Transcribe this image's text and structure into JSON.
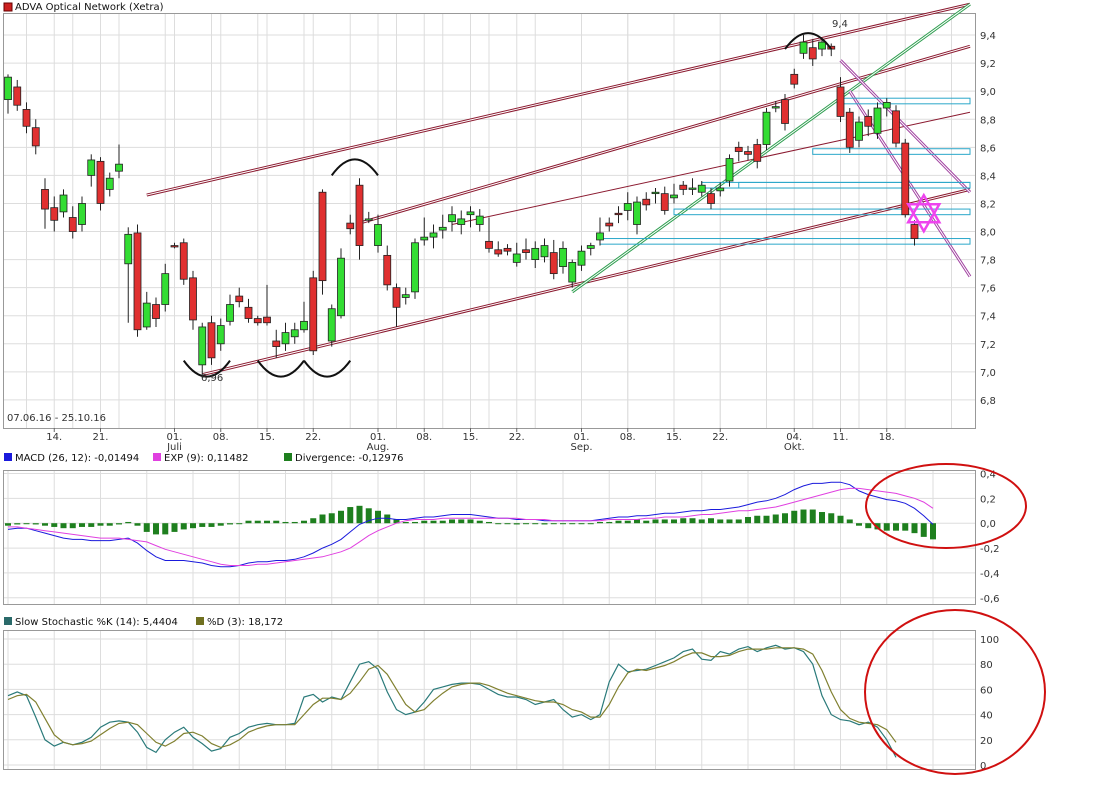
{
  "chart_data": [
    {
      "type": "candlestick",
      "title": "ADVA Optical Network (Xetra)",
      "date_range": "07.06.16 - 25.10.16",
      "ylim": [
        6.6,
        9.55
      ],
      "y_ticks": [
        6.8,
        7.0,
        7.2,
        7.4,
        7.6,
        7.8,
        8.0,
        8.2,
        8.4,
        8.6,
        8.8,
        9.0,
        9.2,
        9.4
      ],
      "y_tick_labels": [
        "6,8",
        "7,0",
        "7,2",
        "7,4",
        "7,6",
        "7,8",
        "8,0",
        "8,2",
        "8,4",
        "8,6",
        "8,8",
        "9,0",
        "9,2",
        "9,4"
      ],
      "x_tick_labels": [
        {
          "day": "14.",
          "index": 5
        },
        {
          "day": "21.",
          "index": 10
        },
        {
          "day": "01.",
          "month": "Juli",
          "index": 18
        },
        {
          "day": "08.",
          "index": 23
        },
        {
          "day": "15.",
          "index": 28
        },
        {
          "day": "22.",
          "index": 33
        },
        {
          "day": "01.",
          "month": "Aug.",
          "index": 40
        },
        {
          "day": "08.",
          "index": 45
        },
        {
          "day": "15.",
          "index": 50
        },
        {
          "day": "22.",
          "index": 55
        },
        {
          "day": "01.",
          "month": "Sep.",
          "index": 62
        },
        {
          "day": "08.",
          "index": 67
        },
        {
          "day": "15.",
          "index": 72
        },
        {
          "day": "22.",
          "index": 77
        },
        {
          "day": "04.",
          "month": "Okt.",
          "index": 85
        },
        {
          "day": "11.",
          "index": 90
        },
        {
          "day": "18.",
          "index": 95
        }
      ],
      "low_annotation": {
        "text": "6,96",
        "index": 21,
        "value": 6.96
      },
      "high_annotation": {
        "text": "9,4",
        "index": 86,
        "value": 9.45
      },
      "candles": [
        [
          8.94,
          9.1,
          9.12,
          8.84
        ],
        [
          9.03,
          8.9,
          9.08,
          8.86
        ],
        [
          8.87,
          8.75,
          8.92,
          8.7
        ],
        [
          8.74,
          8.61,
          8.8,
          8.55
        ],
        [
          8.3,
          8.16,
          8.38,
          8.02
        ],
        [
          8.17,
          8.08,
          8.25,
          8.0
        ],
        [
          8.14,
          8.26,
          8.3,
          8.1
        ],
        [
          8.1,
          8.0,
          8.18,
          7.95
        ],
        [
          8.05,
          8.2,
          8.25,
          8.0
        ],
        [
          8.4,
          8.51,
          8.55,
          8.32
        ],
        [
          8.5,
          8.2,
          8.53,
          8.15
        ],
        [
          8.3,
          8.38,
          8.42,
          8.25
        ],
        [
          8.43,
          8.48,
          8.62,
          8.38
        ],
        [
          7.77,
          7.98,
          8.03,
          7.35
        ],
        [
          7.99,
          7.3,
          8.05,
          7.25
        ],
        [
          7.32,
          7.49,
          7.57,
          7.3
        ],
        [
          7.48,
          7.38,
          7.53,
          7.32
        ],
        [
          7.48,
          7.7,
          7.77,
          7.43
        ],
        [
          7.9,
          7.89,
          7.92,
          7.88
        ],
        [
          7.92,
          7.66,
          7.95,
          7.62
        ],
        [
          7.67,
          7.37,
          7.72,
          7.3
        ],
        [
          7.05,
          7.32,
          7.35,
          6.96
        ],
        [
          7.35,
          7.1,
          7.4,
          7.05
        ],
        [
          7.2,
          7.33,
          7.38,
          7.15
        ],
        [
          7.36,
          7.48,
          7.55,
          7.33
        ],
        [
          7.54,
          7.5,
          7.6,
          7.46
        ],
        [
          7.46,
          7.38,
          7.52,
          7.35
        ],
        [
          7.38,
          7.35,
          7.4,
          7.33
        ],
        [
          7.39,
          7.35,
          7.62,
          7.33
        ],
        [
          7.22,
          7.18,
          7.3,
          7.1
        ],
        [
          7.2,
          7.28,
          7.35,
          7.15
        ],
        [
          7.25,
          7.3,
          7.35,
          7.2
        ],
        [
          7.3,
          7.36,
          7.5,
          7.28
        ],
        [
          7.67,
          7.15,
          7.72,
          7.12
        ],
        [
          8.28,
          7.65,
          8.3,
          7.55
        ],
        [
          7.22,
          7.45,
          7.48,
          7.18
        ],
        [
          7.4,
          7.81,
          7.88,
          7.38
        ],
        [
          8.06,
          8.02,
          8.12,
          7.98
        ],
        [
          8.33,
          7.9,
          8.38,
          7.8
        ],
        [
          8.08,
          8.09,
          8.14,
          8.06
        ],
        [
          7.9,
          8.05,
          8.12,
          7.85
        ],
        [
          7.83,
          7.62,
          7.9,
          7.58
        ],
        [
          7.6,
          7.46,
          7.63,
          7.32
        ],
        [
          7.53,
          7.55,
          7.6,
          7.48
        ],
        [
          7.57,
          7.92,
          7.95,
          7.52
        ],
        [
          7.94,
          7.96,
          8.1,
          7.9
        ],
        [
          7.96,
          7.99,
          8.05,
          7.88
        ],
        [
          8.01,
          8.03,
          8.12,
          7.95
        ],
        [
          8.07,
          8.12,
          8.18,
          8.0
        ],
        [
          8.05,
          8.09,
          8.15,
          7.98
        ],
        [
          8.12,
          8.14,
          8.18,
          8.03
        ],
        [
          8.05,
          8.11,
          8.16,
          8.0
        ],
        [
          7.93,
          7.88,
          8.1,
          7.85
        ],
        [
          7.87,
          7.84,
          7.93,
          7.82
        ],
        [
          7.88,
          7.86,
          7.91,
          7.83
        ],
        [
          7.78,
          7.84,
          7.92,
          7.75
        ],
        [
          7.87,
          7.85,
          7.95,
          7.8
        ],
        [
          7.8,
          7.88,
          7.93,
          7.74
        ],
        [
          7.82,
          7.9,
          7.95,
          7.78
        ],
        [
          7.85,
          7.7,
          7.94,
          7.66
        ],
        [
          7.75,
          7.88,
          7.93,
          7.7
        ],
        [
          7.64,
          7.78,
          7.8,
          7.6
        ],
        [
          7.76,
          7.86,
          7.9,
          7.72
        ],
        [
          7.88,
          7.9,
          7.92,
          7.83
        ],
        [
          7.94,
          7.99,
          8.1,
          7.9
        ],
        [
          8.06,
          8.04,
          8.1,
          8.0
        ],
        [
          8.13,
          8.12,
          8.18,
          8.06
        ],
        [
          8.15,
          8.2,
          8.28,
          8.08
        ],
        [
          8.05,
          8.21,
          8.25,
          7.98
        ],
        [
          8.23,
          8.19,
          8.28,
          8.15
        ],
        [
          8.27,
          8.28,
          8.31,
          8.2
        ],
        [
          8.27,
          8.15,
          8.32,
          8.12
        ],
        [
          8.24,
          8.26,
          8.34,
          8.2
        ],
        [
          8.33,
          8.3,
          8.36,
          8.26
        ],
        [
          8.3,
          8.31,
          8.38,
          8.26
        ],
        [
          8.28,
          8.33,
          8.36,
          8.25
        ],
        [
          8.27,
          8.2,
          8.31,
          8.16
        ],
        [
          8.29,
          8.31,
          8.35,
          8.25
        ],
        [
          8.36,
          8.52,
          8.55,
          8.32
        ],
        [
          8.6,
          8.57,
          8.64,
          8.5
        ],
        [
          8.57,
          8.55,
          8.61,
          8.51
        ],
        [
          8.62,
          8.5,
          8.66,
          8.45
        ],
        [
          8.62,
          8.85,
          8.88,
          8.58
        ],
        [
          8.88,
          8.89,
          8.93,
          8.85
        ],
        [
          8.94,
          8.77,
          8.98,
          8.72
        ],
        [
          9.12,
          9.05,
          9.16,
          9.02
        ],
        [
          9.27,
          9.35,
          9.4,
          9.23
        ],
        [
          9.31,
          9.23,
          9.37,
          9.18
        ],
        [
          9.3,
          9.35,
          9.37,
          9.25
        ],
        [
          9.32,
          9.3,
          9.34,
          9.25
        ],
        [
          9.03,
          8.82,
          9.1,
          8.78
        ],
        [
          8.85,
          8.6,
          8.88,
          8.56
        ],
        [
          8.65,
          8.78,
          8.82,
          8.6
        ],
        [
          8.82,
          8.75,
          8.87,
          8.68
        ],
        [
          8.7,
          8.88,
          8.92,
          8.66
        ],
        [
          8.88,
          8.92,
          8.95,
          8.82
        ],
        [
          8.86,
          8.63,
          8.9,
          8.6
        ],
        [
          8.63,
          8.12,
          8.66,
          8.1
        ],
        [
          8.05,
          7.95,
          8.08,
          7.9
        ]
      ],
      "trend_lines": [
        {
          "color": "#8b1a30",
          "from": [
            15,
            8.26
          ],
          "to": [
            104,
            9.62
          ],
          "double": true
        },
        {
          "color": "#8b1a30",
          "from": [
            38,
            8.06
          ],
          "to": [
            104,
            9.32
          ],
          "double": true
        },
        {
          "color": "#8b1a30",
          "from": [
            48,
            8.05
          ],
          "to": [
            104,
            8.85
          ],
          "double": false
        },
        {
          "color": "#8b1a30",
          "from": [
            21,
            6.98
          ],
          "to": [
            104,
            8.3
          ],
          "double": true
        },
        {
          "color": "#2e9e4f",
          "from": [
            61,
            7.57
          ],
          "to": [
            104,
            9.62
          ],
          "double": true
        },
        {
          "color": "#a040a0",
          "from": [
            90,
            9.22
          ],
          "to": [
            104,
            8.28
          ],
          "double": true
        },
        {
          "color": "#a040a0",
          "from": [
            91,
            9.0
          ],
          "to": [
            104,
            7.68
          ],
          "double": true
        }
      ],
      "resistance_boxes": [
        {
          "from": [
            79,
            8.35
          ],
          "to": [
            104,
            8.31
          ]
        },
        {
          "from": [
            75,
            8.35
          ],
          "to": [
            104,
            8.31
          ]
        },
        {
          "from": [
            90,
            8.95
          ],
          "to": [
            104,
            8.91
          ]
        },
        {
          "from": [
            87,
            8.59
          ],
          "to": [
            104,
            8.55
          ]
        },
        {
          "from": [
            72,
            8.16
          ],
          "to": [
            104,
            8.12
          ]
        },
        {
          "from": [
            64,
            7.95
          ],
          "to": [
            104,
            7.91
          ]
        }
      ],
      "pattern_arcs": [
        {
          "x0": 19,
          "x1": 24,
          "y": 7.08,
          "type": "bottom"
        },
        {
          "x0": 27,
          "x1": 32,
          "y": 7.08,
          "type": "bottom"
        },
        {
          "x0": 32,
          "x1": 37,
          "y": 7.08,
          "type": "bottom"
        },
        {
          "x0": 35,
          "x1": 40,
          "y": 8.4,
          "type": "top"
        },
        {
          "x0": 84,
          "x1": 89,
          "y": 9.3,
          "type": "top"
        }
      ],
      "star_marker": {
        "index": 99,
        "value": 8.13,
        "color": "#ee44ee"
      }
    },
    {
      "type": "macd",
      "legend": [
        {
          "label": "MACD (26, 12): -0,01494",
          "color": "#1a1adc"
        },
        {
          "label": "EXP (9): 0,11482",
          "color": "#e040e0"
        },
        {
          "label": "Divergence: -0,12976",
          "color": "#1e7f1e"
        }
      ],
      "ylim": [
        -0.65,
        0.42
      ],
      "y_ticks": [
        0.4,
        0.2,
        0.0,
        -0.2,
        -0.4,
        -0.6
      ],
      "y_tick_labels": [
        "0,4",
        "0,2",
        "0,0",
        "-0,2",
        "-0,4",
        "-0,6"
      ],
      "macd": [
        -0.05,
        -0.04,
        -0.04,
        -0.06,
        -0.08,
        -0.1,
        -0.12,
        -0.13,
        -0.13,
        -0.14,
        -0.14,
        -0.14,
        -0.13,
        -0.12,
        -0.16,
        -0.22,
        -0.27,
        -0.3,
        -0.3,
        -0.3,
        -0.31,
        -0.32,
        -0.34,
        -0.35,
        -0.35,
        -0.34,
        -0.32,
        -0.31,
        -0.31,
        -0.3,
        -0.3,
        -0.29,
        -0.27,
        -0.24,
        -0.2,
        -0.17,
        -0.13,
        -0.07,
        -0.01,
        0.02,
        0.04,
        0.04,
        0.03,
        0.03,
        0.04,
        0.05,
        0.05,
        0.06,
        0.07,
        0.07,
        0.07,
        0.06,
        0.05,
        0.04,
        0.04,
        0.03,
        0.03,
        0.03,
        0.02,
        0.02,
        0.02,
        0.02,
        0.02,
        0.02,
        0.03,
        0.04,
        0.05,
        0.05,
        0.06,
        0.06,
        0.07,
        0.08,
        0.08,
        0.09,
        0.1,
        0.1,
        0.11,
        0.11,
        0.12,
        0.13,
        0.15,
        0.17,
        0.18,
        0.2,
        0.23,
        0.27,
        0.3,
        0.32,
        0.32,
        0.33,
        0.33,
        0.31,
        0.26,
        0.23,
        0.21,
        0.19,
        0.18,
        0.16,
        0.12,
        0.06,
        -0.01
      ],
      "exp": [
        -0.03,
        -0.03,
        -0.04,
        -0.05,
        -0.06,
        -0.07,
        -0.08,
        -0.09,
        -0.1,
        -0.11,
        -0.12,
        -0.12,
        -0.12,
        -0.13,
        -0.14,
        -0.15,
        -0.18,
        -0.21,
        -0.23,
        -0.25,
        -0.27,
        -0.29,
        -0.31,
        -0.33,
        -0.34,
        -0.34,
        -0.34,
        -0.33,
        -0.33,
        -0.32,
        -0.31,
        -0.3,
        -0.29,
        -0.28,
        -0.27,
        -0.25,
        -0.23,
        -0.2,
        -0.15,
        -0.1,
        -0.06,
        -0.03,
        0.0,
        0.02,
        0.03,
        0.03,
        0.03,
        0.04,
        0.04,
        0.04,
        0.04,
        0.04,
        0.04,
        0.04,
        0.04,
        0.04,
        0.03,
        0.03,
        0.03,
        0.02,
        0.02,
        0.02,
        0.02,
        0.02,
        0.02,
        0.03,
        0.03,
        0.03,
        0.03,
        0.04,
        0.04,
        0.05,
        0.05,
        0.05,
        0.06,
        0.07,
        0.07,
        0.08,
        0.09,
        0.1,
        0.1,
        0.11,
        0.12,
        0.13,
        0.15,
        0.17,
        0.19,
        0.21,
        0.23,
        0.25,
        0.27,
        0.28,
        0.28,
        0.27,
        0.26,
        0.25,
        0.24,
        0.22,
        0.2,
        0.17,
        0.12
      ]
    },
    {
      "type": "stochastic",
      "legend": [
        {
          "label": "Slow Stochastic %K (14): 5,4404",
          "color": "#2a6a6a"
        },
        {
          "label": "%D (3): 18,172",
          "color": "#707020"
        }
      ],
      "ylim": [
        0,
        100
      ],
      "y_ticks": [
        0,
        20,
        40,
        60,
        80,
        100
      ],
      "y_tick_labels": [
        "0",
        "20",
        "40",
        "60",
        "80",
        "100"
      ],
      "k": [
        55,
        58,
        55,
        38,
        20,
        15,
        18,
        16,
        18,
        22,
        30,
        34,
        35,
        34,
        26,
        14,
        10,
        20,
        26,
        30,
        22,
        17,
        11,
        13,
        22,
        25,
        30,
        32,
        33,
        32,
        32,
        33,
        54,
        56,
        50,
        54,
        52,
        66,
        80,
        82,
        76,
        58,
        44,
        40,
        42,
        50,
        60,
        62,
        64,
        65,
        65,
        64,
        60,
        56,
        54,
        54,
        52,
        48,
        50,
        52,
        44,
        38,
        40,
        36,
        40,
        66,
        80,
        74,
        75,
        76,
        79,
        82,
        85,
        90,
        92,
        84,
        83,
        90,
        88,
        92,
        94,
        90,
        93,
        95,
        92,
        93,
        90,
        80,
        55,
        40,
        36,
        35,
        32,
        34,
        30,
        20,
        6
      ],
      "d": [
        52,
        55,
        56,
        50,
        37,
        24,
        18,
        16,
        17,
        19,
        24,
        29,
        33,
        34,
        32,
        25,
        18,
        15,
        19,
        25,
        26,
        23,
        17,
        14,
        16,
        20,
        26,
        29,
        31,
        32,
        32,
        32,
        40,
        48,
        53,
        53,
        52,
        57,
        66,
        76,
        79,
        72,
        60,
        48,
        42,
        44,
        51,
        57,
        62,
        64,
        65,
        65,
        63,
        60,
        57,
        55,
        53,
        51,
        50,
        50,
        48,
        44,
        42,
        38,
        38,
        48,
        62,
        73,
        76,
        75,
        77,
        79,
        82,
        86,
        89,
        89,
        86,
        86,
        87,
        90,
        92,
        92,
        92,
        93,
        93,
        93,
        92,
        88,
        75,
        58,
        44,
        37,
        34,
        33,
        32,
        28,
        18
      ]
    }
  ]
}
